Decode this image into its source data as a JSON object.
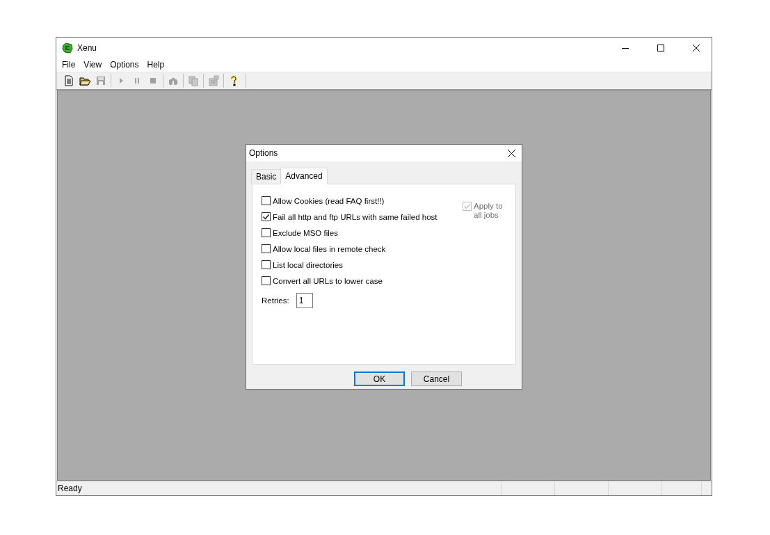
{
  "window": {
    "title": "Xenu"
  },
  "menu": [
    "File",
    "View",
    "Options",
    "Help"
  ],
  "toolbar": [
    [
      {
        "kind": "new",
        "disabled": false
      },
      {
        "kind": "open",
        "disabled": false
      },
      {
        "kind": "save",
        "disabled": true
      }
    ],
    [
      {
        "kind": "play",
        "disabled": true
      },
      {
        "kind": "pause",
        "disabled": true
      },
      {
        "kind": "stop",
        "disabled": true
      }
    ],
    [
      {
        "kind": "find",
        "disabled": true
      }
    ],
    [
      {
        "kind": "copy",
        "disabled": true
      }
    ],
    [
      {
        "kind": "properties",
        "disabled": true
      }
    ],
    [
      {
        "kind": "help",
        "disabled": false
      }
    ]
  ],
  "dialog": {
    "title": "Options",
    "tabs": [
      {
        "label": "Basic",
        "selected": false
      },
      {
        "label": "Advanced",
        "selected": true
      }
    ],
    "options": [
      {
        "label": "Allow Cookies (read FAQ first!!)",
        "checked": false
      },
      {
        "label": "Fail all http and ftp URLs with same failed host",
        "checked": true
      },
      {
        "label": "Exclude MSO files",
        "checked": false
      },
      {
        "label": "Allow local files in remote check",
        "checked": false
      },
      {
        "label": "List local directories",
        "checked": false
      },
      {
        "label": "Convert all URLs to lower case",
        "checked": false
      }
    ],
    "apply_to_all": {
      "label": "Apply to all jobs",
      "checked": true,
      "disabled": true
    },
    "retries": {
      "label": "Retries:",
      "value": "1"
    },
    "buttons": [
      {
        "label": "OK",
        "default": true
      },
      {
        "label": "Cancel",
        "default": false
      }
    ]
  },
  "status_bar": {
    "text": "Ready"
  }
}
